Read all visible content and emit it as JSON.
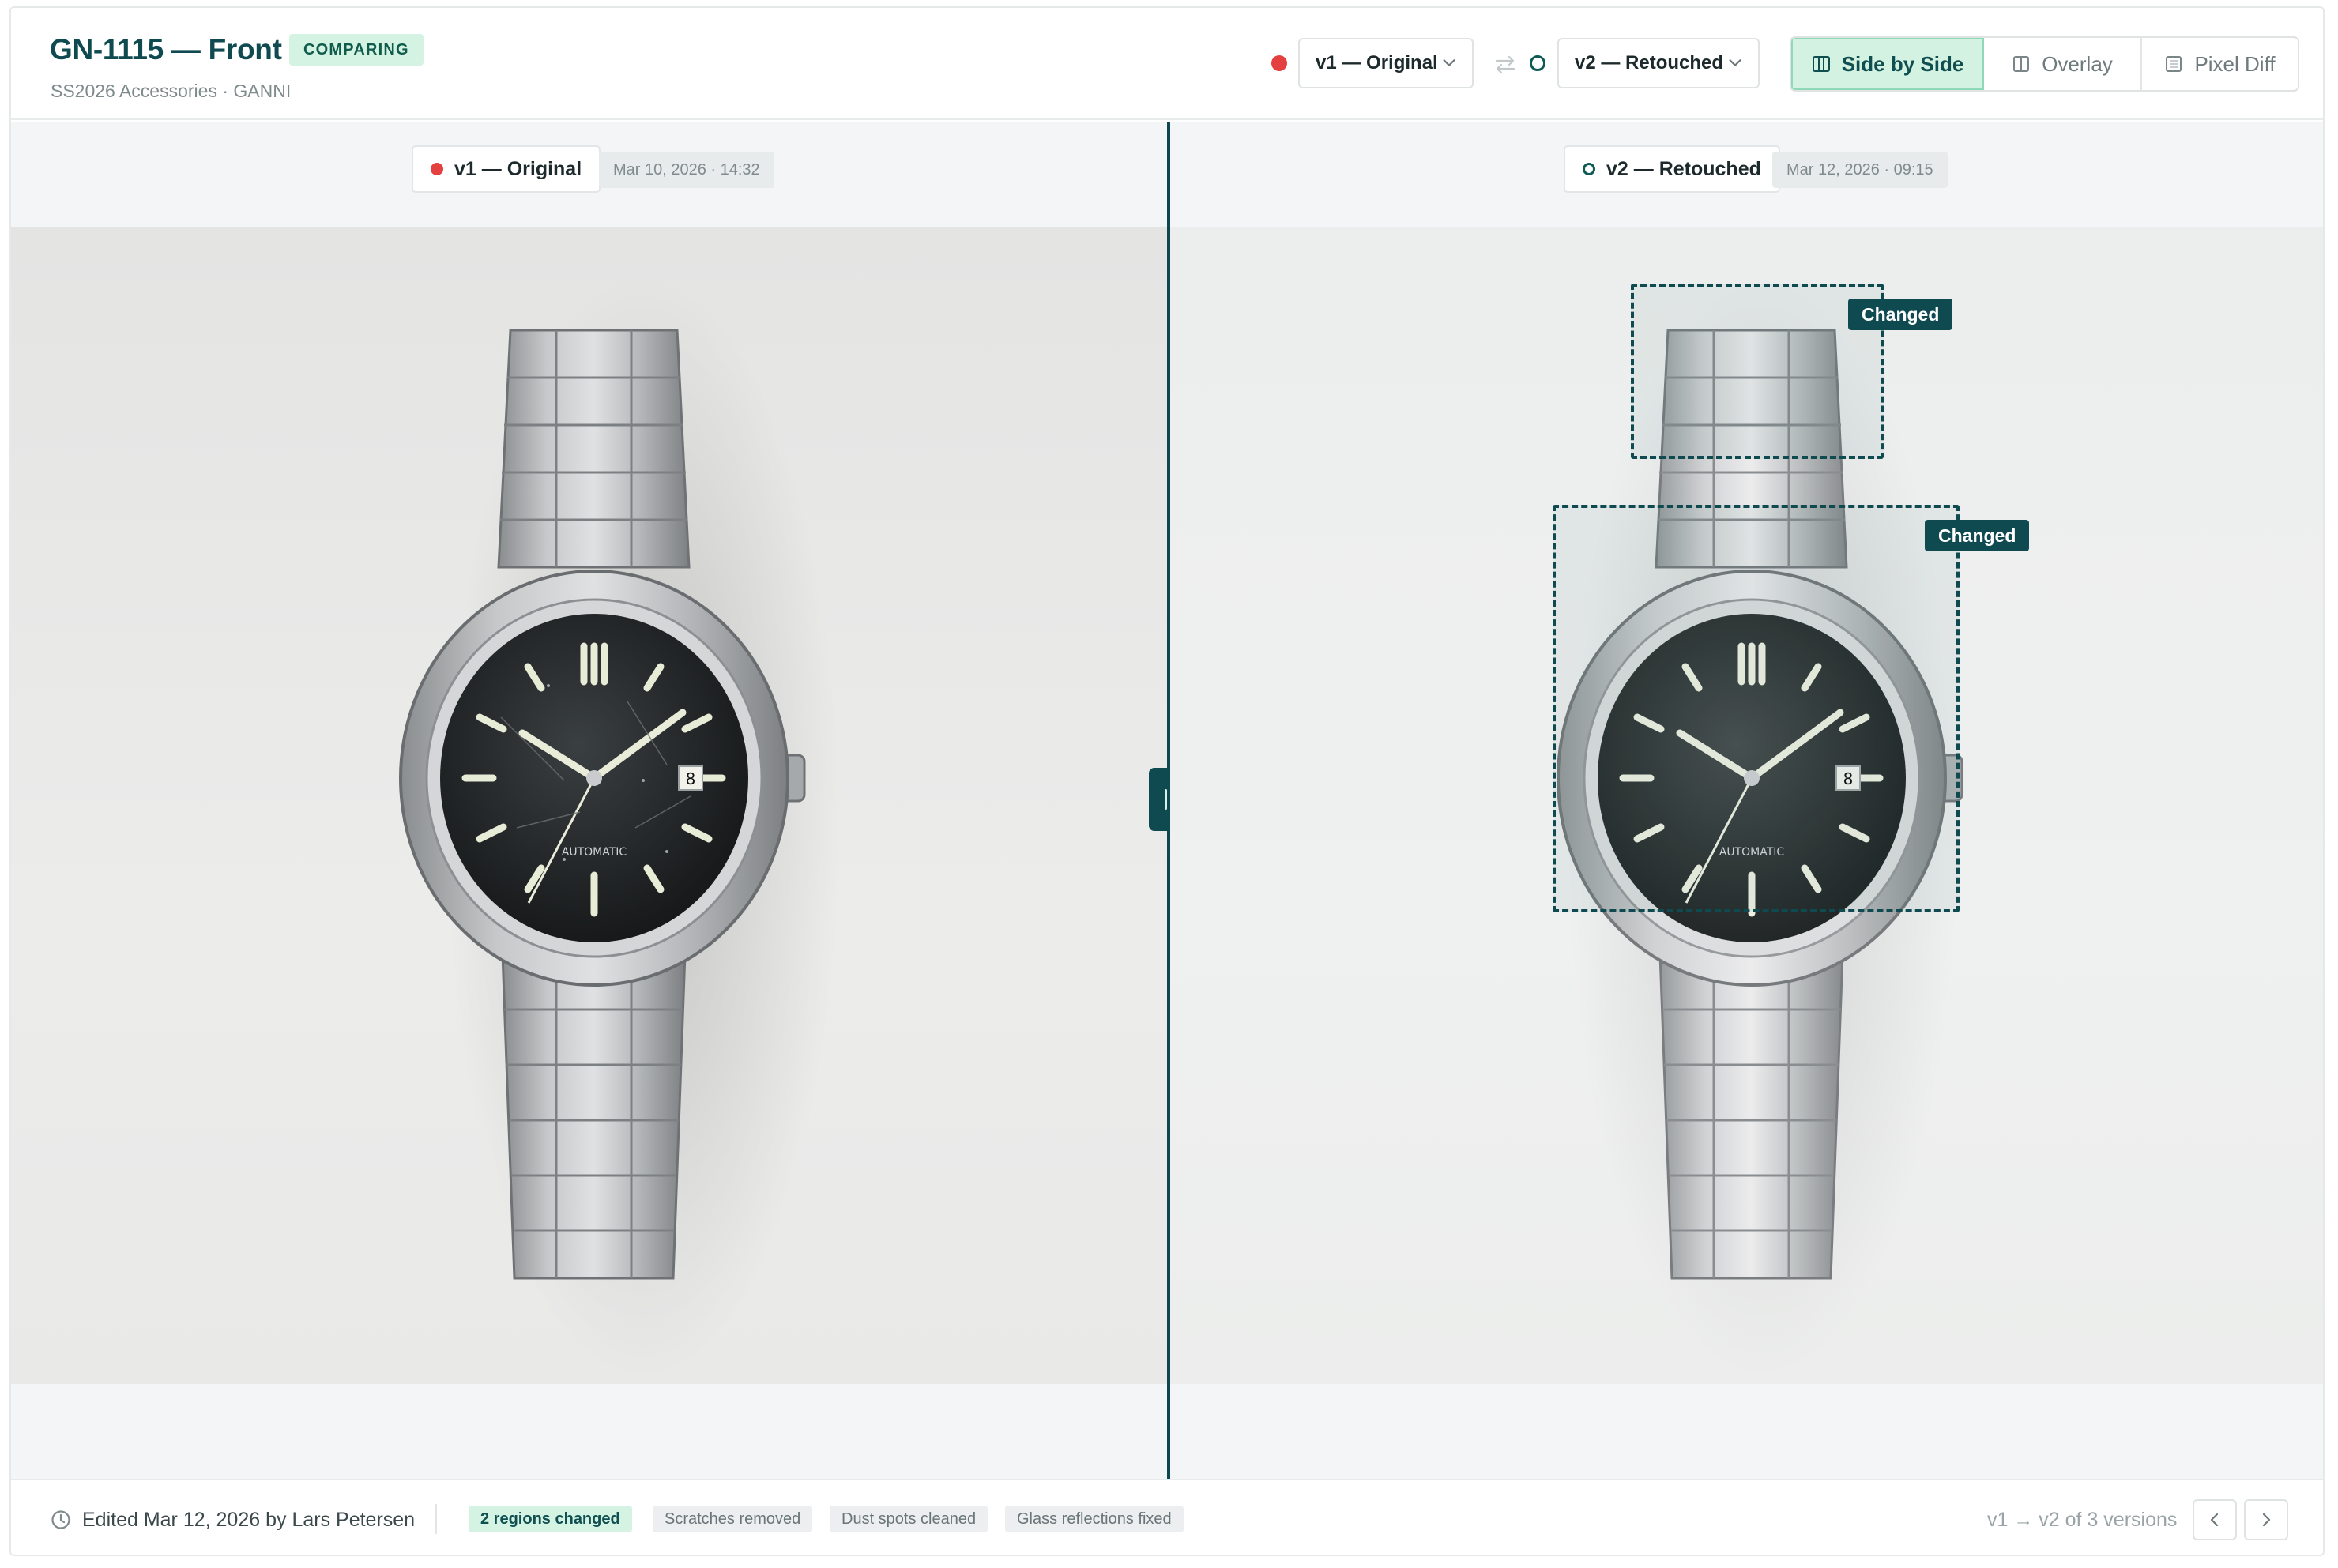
{
  "header": {
    "title": "GN-1115 — Front",
    "status_badge": "COMPARING",
    "subtitle": "SS2026 Accessories · GANNI",
    "version_a": "v1 — Original",
    "version_b": "v2 — Retouched",
    "view_modes": [
      {
        "label": "Side by Side",
        "active": true
      },
      {
        "label": "Overlay",
        "active": false
      },
      {
        "label": "Pixel Diff",
        "active": false
      }
    ]
  },
  "left_pane": {
    "version_label": "v1 — Original",
    "date": "Mar 10, 2026 · 14:32",
    "dial_text": "AUTOMATIC",
    "date_window": "8"
  },
  "right_pane": {
    "version_label": "v2 — Retouched",
    "date": "Mar 12, 2026 · 09:15",
    "dial_text": "AUTOMATIC",
    "date_window": "8",
    "changed_regions": [
      {
        "label": "Changed"
      },
      {
        "label": "Changed"
      }
    ]
  },
  "footer": {
    "edited": "Edited Mar 12, 2026 by Lars Petersen",
    "chips": [
      "2 regions changed",
      "Scratches removed",
      "Dust spots cleaned",
      "Glass reflections fixed"
    ],
    "version_count": "v1 → v2 of 3 versions"
  },
  "colors": {
    "brand": "#0e4a50",
    "accent_green": "#d4f2e2",
    "original_dot": "#e4403f"
  },
  "icons": [
    "clock-icon",
    "swap-icon",
    "chevron-down-icon",
    "columns-icon",
    "overlay-icon",
    "pixel-diff-icon",
    "chevron-left-icon",
    "chevron-right-icon",
    "drag-handle-icon"
  ]
}
